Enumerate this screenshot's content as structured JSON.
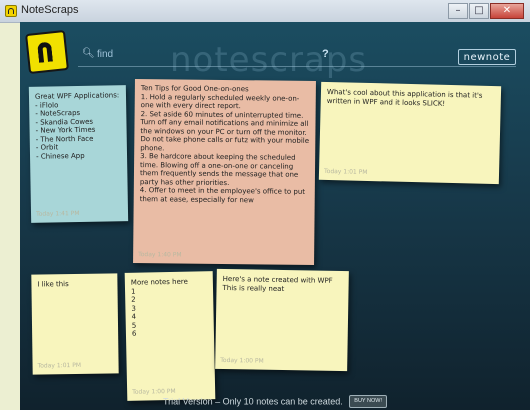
{
  "window": {
    "title": "NoteScraps",
    "buttons": {
      "minimize": "–",
      "maximize": "□",
      "close": "✕"
    }
  },
  "toolbar": {
    "search_placeholder": "find",
    "watermark": "notescraps",
    "help_label": "?",
    "newnote_label": "newnote"
  },
  "notes": [
    {
      "id": "blue",
      "color": "#a8d6d8",
      "body": "Great WPF Applications:\n- iFlolo\n- NoteScraps\n- Skandia Cowes\n- New York Times\n- The North Face\n- Orbit\n- Chinese App",
      "timestamp": "Today 1:41 PM"
    },
    {
      "id": "orange",
      "color": "#e9bca5",
      "body": "Ten Tips for Good One-on-ones\n 1. Hold a regularly scheduled weekly one-on-one with every direct report.\n 2. Set aside 60 minutes of uninterrupted time. Turn off any email notifications and minimize all the windows on your PC or turn off the monitor. Do not take phone calls or futz with your mobile phone.\n 3. Be hardcore about keeping the scheduled time. Blowing off a one-on-one or canceling them frequently sends the message that one party has other priorities.\n 4. Offer to meet in the employee's office to put them at ease, especially for new",
      "timestamp": "Today 1:40 PM"
    },
    {
      "id": "yellow1",
      "color": "#f8f5bd",
      "body": "What's cool about this application is that it's written in WPF and it looks SLICK!",
      "timestamp": "Today 1:01 PM"
    },
    {
      "id": "yellow2",
      "color": "#f8f5bd",
      "body": "I like this",
      "timestamp": "Today 1:01 PM"
    },
    {
      "id": "yellow3",
      "color": "#f8f5bd",
      "body": "More notes here\n1\n2\n3\n4\n5\n6",
      "timestamp": "Today 1:00 PM"
    },
    {
      "id": "yellow4",
      "color": "#f8f5bd",
      "body": "Here's a note created with WPF\nThis is really neat",
      "timestamp": "Today 1:00 PM"
    }
  ],
  "footer": {
    "trial_text": "Trial Version – Only 10 notes can be created.",
    "buy_now_label": "BUY NOW!"
  },
  "colors": {
    "board_top": "#1b4d61",
    "board_bottom": "#10222d",
    "logo": "#f1e100"
  }
}
